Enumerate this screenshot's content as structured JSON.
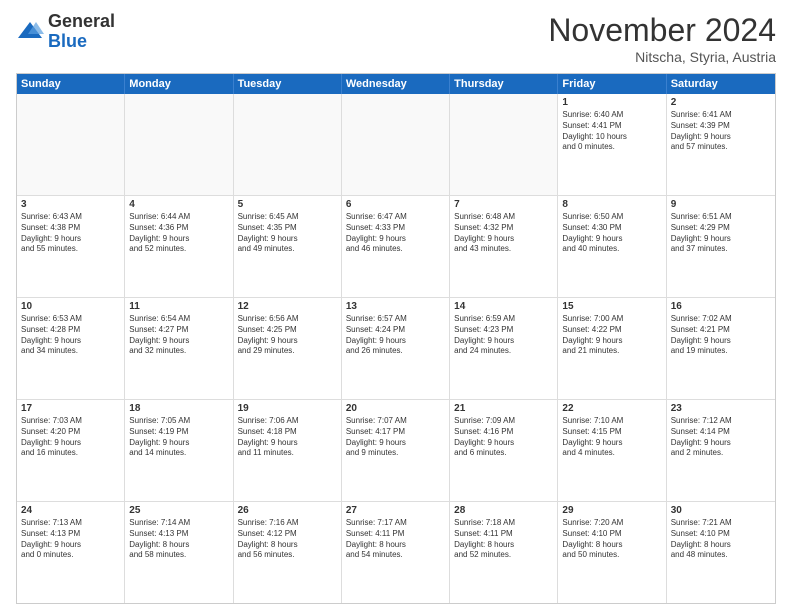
{
  "header": {
    "logo_general": "General",
    "logo_blue": "Blue",
    "month_title": "November 2024",
    "location": "Nitscha, Styria, Austria"
  },
  "weekdays": [
    "Sunday",
    "Monday",
    "Tuesday",
    "Wednesday",
    "Thursday",
    "Friday",
    "Saturday"
  ],
  "rows": [
    [
      {
        "day": "",
        "text": "",
        "empty": true
      },
      {
        "day": "",
        "text": "",
        "empty": true
      },
      {
        "day": "",
        "text": "",
        "empty": true
      },
      {
        "day": "",
        "text": "",
        "empty": true
      },
      {
        "day": "",
        "text": "",
        "empty": true
      },
      {
        "day": "1",
        "text": "Sunrise: 6:40 AM\nSunset: 4:41 PM\nDaylight: 10 hours\nand 0 minutes.",
        "empty": false
      },
      {
        "day": "2",
        "text": "Sunrise: 6:41 AM\nSunset: 4:39 PM\nDaylight: 9 hours\nand 57 minutes.",
        "empty": false
      }
    ],
    [
      {
        "day": "3",
        "text": "Sunrise: 6:43 AM\nSunset: 4:38 PM\nDaylight: 9 hours\nand 55 minutes.",
        "empty": false
      },
      {
        "day": "4",
        "text": "Sunrise: 6:44 AM\nSunset: 4:36 PM\nDaylight: 9 hours\nand 52 minutes.",
        "empty": false
      },
      {
        "day": "5",
        "text": "Sunrise: 6:45 AM\nSunset: 4:35 PM\nDaylight: 9 hours\nand 49 minutes.",
        "empty": false
      },
      {
        "day": "6",
        "text": "Sunrise: 6:47 AM\nSunset: 4:33 PM\nDaylight: 9 hours\nand 46 minutes.",
        "empty": false
      },
      {
        "day": "7",
        "text": "Sunrise: 6:48 AM\nSunset: 4:32 PM\nDaylight: 9 hours\nand 43 minutes.",
        "empty": false
      },
      {
        "day": "8",
        "text": "Sunrise: 6:50 AM\nSunset: 4:30 PM\nDaylight: 9 hours\nand 40 minutes.",
        "empty": false
      },
      {
        "day": "9",
        "text": "Sunrise: 6:51 AM\nSunset: 4:29 PM\nDaylight: 9 hours\nand 37 minutes.",
        "empty": false
      }
    ],
    [
      {
        "day": "10",
        "text": "Sunrise: 6:53 AM\nSunset: 4:28 PM\nDaylight: 9 hours\nand 34 minutes.",
        "empty": false
      },
      {
        "day": "11",
        "text": "Sunrise: 6:54 AM\nSunset: 4:27 PM\nDaylight: 9 hours\nand 32 minutes.",
        "empty": false
      },
      {
        "day": "12",
        "text": "Sunrise: 6:56 AM\nSunset: 4:25 PM\nDaylight: 9 hours\nand 29 minutes.",
        "empty": false
      },
      {
        "day": "13",
        "text": "Sunrise: 6:57 AM\nSunset: 4:24 PM\nDaylight: 9 hours\nand 26 minutes.",
        "empty": false
      },
      {
        "day": "14",
        "text": "Sunrise: 6:59 AM\nSunset: 4:23 PM\nDaylight: 9 hours\nand 24 minutes.",
        "empty": false
      },
      {
        "day": "15",
        "text": "Sunrise: 7:00 AM\nSunset: 4:22 PM\nDaylight: 9 hours\nand 21 minutes.",
        "empty": false
      },
      {
        "day": "16",
        "text": "Sunrise: 7:02 AM\nSunset: 4:21 PM\nDaylight: 9 hours\nand 19 minutes.",
        "empty": false
      }
    ],
    [
      {
        "day": "17",
        "text": "Sunrise: 7:03 AM\nSunset: 4:20 PM\nDaylight: 9 hours\nand 16 minutes.",
        "empty": false
      },
      {
        "day": "18",
        "text": "Sunrise: 7:05 AM\nSunset: 4:19 PM\nDaylight: 9 hours\nand 14 minutes.",
        "empty": false
      },
      {
        "day": "19",
        "text": "Sunrise: 7:06 AM\nSunset: 4:18 PM\nDaylight: 9 hours\nand 11 minutes.",
        "empty": false
      },
      {
        "day": "20",
        "text": "Sunrise: 7:07 AM\nSunset: 4:17 PM\nDaylight: 9 hours\nand 9 minutes.",
        "empty": false
      },
      {
        "day": "21",
        "text": "Sunrise: 7:09 AM\nSunset: 4:16 PM\nDaylight: 9 hours\nand 6 minutes.",
        "empty": false
      },
      {
        "day": "22",
        "text": "Sunrise: 7:10 AM\nSunset: 4:15 PM\nDaylight: 9 hours\nand 4 minutes.",
        "empty": false
      },
      {
        "day": "23",
        "text": "Sunrise: 7:12 AM\nSunset: 4:14 PM\nDaylight: 9 hours\nand 2 minutes.",
        "empty": false
      }
    ],
    [
      {
        "day": "24",
        "text": "Sunrise: 7:13 AM\nSunset: 4:13 PM\nDaylight: 9 hours\nand 0 minutes.",
        "empty": false
      },
      {
        "day": "25",
        "text": "Sunrise: 7:14 AM\nSunset: 4:13 PM\nDaylight: 8 hours\nand 58 minutes.",
        "empty": false
      },
      {
        "day": "26",
        "text": "Sunrise: 7:16 AM\nSunset: 4:12 PM\nDaylight: 8 hours\nand 56 minutes.",
        "empty": false
      },
      {
        "day": "27",
        "text": "Sunrise: 7:17 AM\nSunset: 4:11 PM\nDaylight: 8 hours\nand 54 minutes.",
        "empty": false
      },
      {
        "day": "28",
        "text": "Sunrise: 7:18 AM\nSunset: 4:11 PM\nDaylight: 8 hours\nand 52 minutes.",
        "empty": false
      },
      {
        "day": "29",
        "text": "Sunrise: 7:20 AM\nSunset: 4:10 PM\nDaylight: 8 hours\nand 50 minutes.",
        "empty": false
      },
      {
        "day": "30",
        "text": "Sunrise: 7:21 AM\nSunset: 4:10 PM\nDaylight: 8 hours\nand 48 minutes.",
        "empty": false
      }
    ]
  ]
}
